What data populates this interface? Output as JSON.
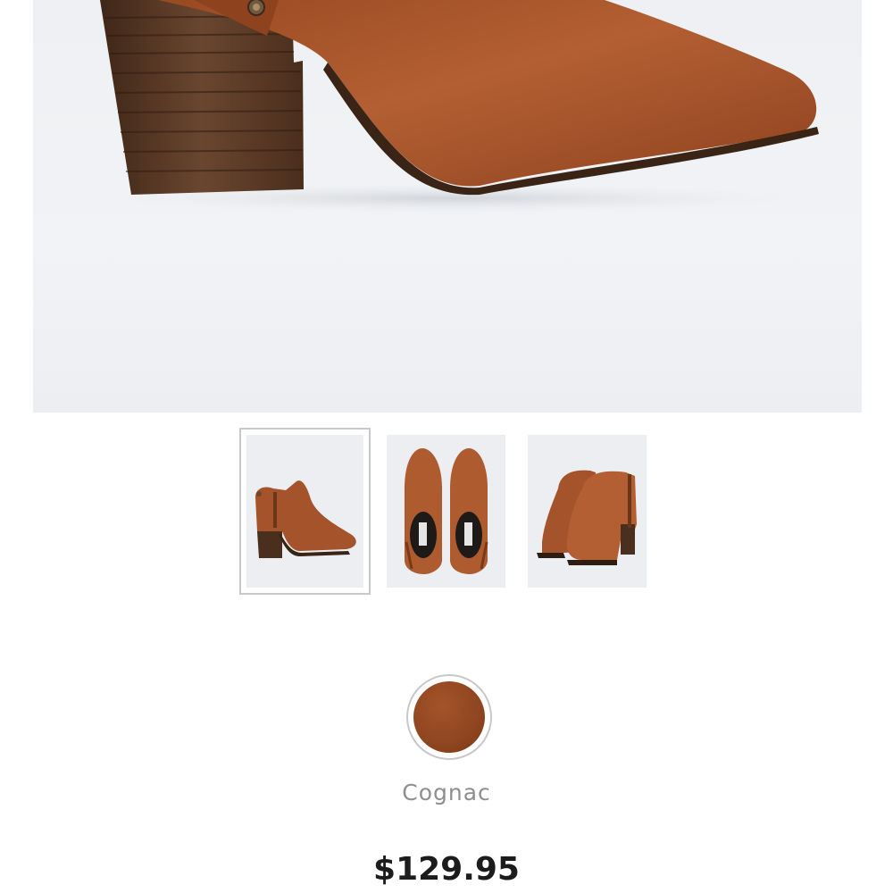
{
  "product": {
    "main_image": "ankle-boot-side-closeup",
    "thumbnails": [
      {
        "image": "boot-side-view",
        "selected": true
      },
      {
        "image": "boots-top-view",
        "selected": false
      },
      {
        "image": "boots-rear-pair-view",
        "selected": false
      }
    ],
    "color": {
      "name": "Cognac",
      "swatch_hex": "#8f451f",
      "selected": true
    },
    "price": "$129.95"
  },
  "colors": {
    "background": "#ffffff",
    "image_backdrop": "#eef0f3",
    "leather": "#a9542a",
    "heel": "#5a3a26",
    "text_muted": "#8f8f8f",
    "text_price": "#1c1c1c"
  }
}
